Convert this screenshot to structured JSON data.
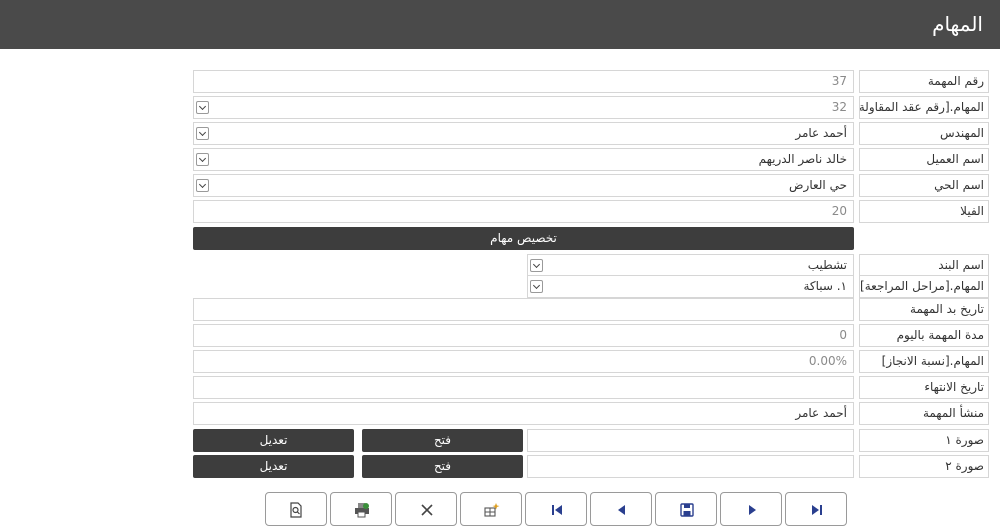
{
  "header": {
    "title": "المهام"
  },
  "fields": [
    {
      "label": "رقم المهمة",
      "value": "37"
    },
    {
      "label": "المهام.[رقم عقد المقاولة]",
      "value": "32"
    },
    {
      "label": "المهندس",
      "value": "أحمد عامر"
    },
    {
      "label": "اسم العميل",
      "value": "خالد ناصر الدريهم"
    },
    {
      "label": "اسم الحي",
      "value": "حي العارض"
    },
    {
      "label": "الفيلا",
      "value": "20"
    },
    {
      "label": "اسم البند",
      "value": "تشطيب"
    },
    {
      "label": "المهام.[مراحل المراجعة]",
      "value": "١. سباكة"
    },
    {
      "label": "تاريخ بد المهمة",
      "value": ""
    },
    {
      "label": "مدة المهمة باليوم",
      "value": "0"
    },
    {
      "label": "المهام.[نسبة الانجاز]",
      "value": "0.00%"
    },
    {
      "label": "تاريخ الانتهاء",
      "value": ""
    },
    {
      "label": "منشأ المهمة",
      "value": "أحمد عامر"
    }
  ],
  "assign_button": "تخصيص مهام",
  "images": [
    {
      "label": "صورة ١",
      "open": "فتح",
      "edit": "تعديل"
    },
    {
      "label": "صورة ٢",
      "open": "فتح",
      "edit": "تعديل"
    }
  ],
  "toolbar": {
    "buttons": [
      "preview-icon",
      "print-icon",
      "close-icon",
      "new-record-icon",
      "first-record-icon",
      "previous-record-icon",
      "save-icon",
      "next-record-icon",
      "last-record-icon"
    ]
  }
}
